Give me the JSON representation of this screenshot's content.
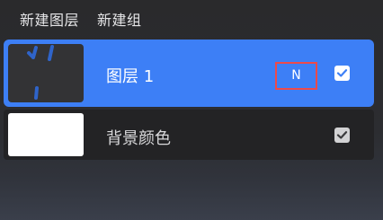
{
  "header": {
    "new_layer_label": "新建图层",
    "new_group_label": "新建组"
  },
  "layers": [
    {
      "name": "图层 1",
      "blend_mode": "N",
      "visible": true,
      "selected": true
    },
    {
      "name": "背景颜色",
      "visible": true,
      "selected": false
    }
  ],
  "colors": {
    "accent": "#3d7ff6",
    "highlight_border": "#ee4a4a",
    "stroke": "#2f64c9"
  },
  "icons": {
    "check": "check-icon"
  }
}
